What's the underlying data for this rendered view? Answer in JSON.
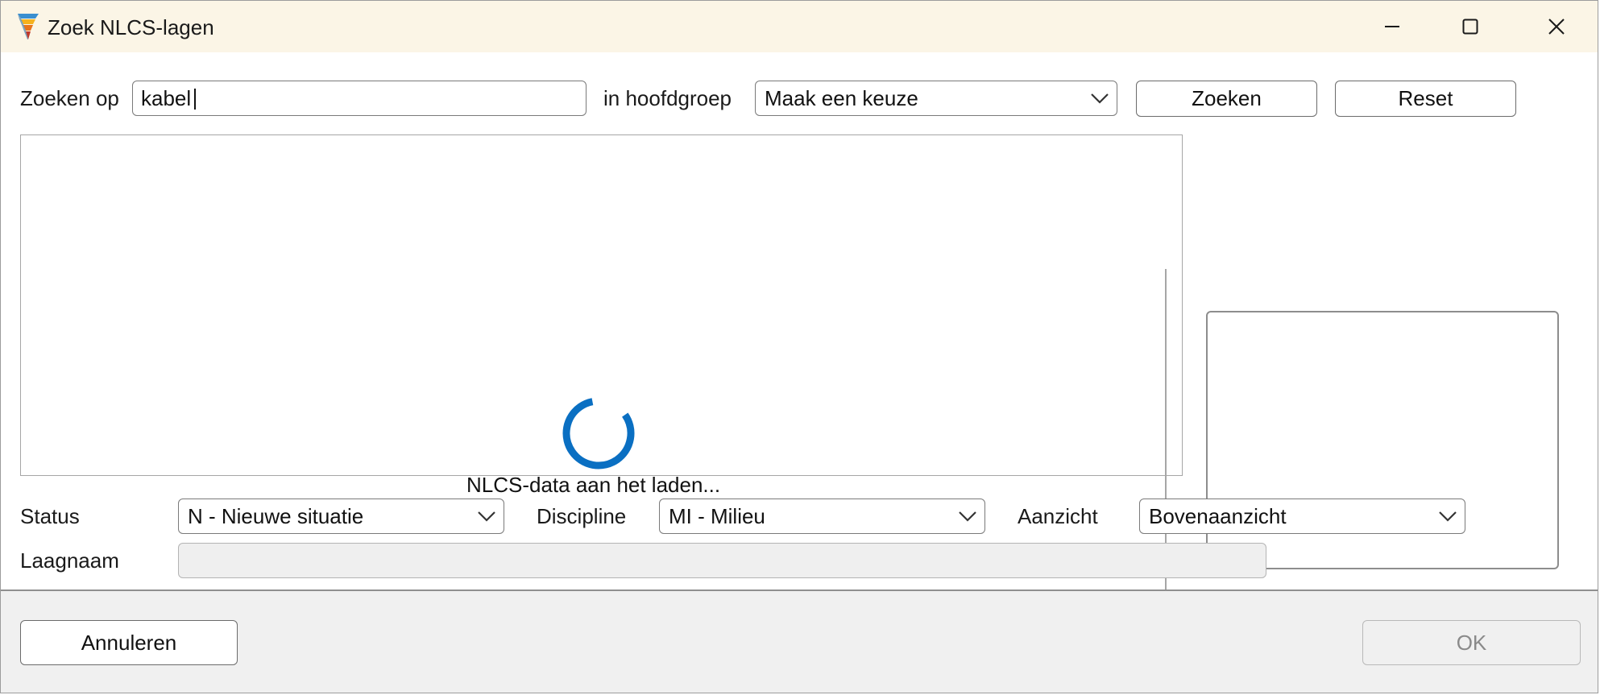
{
  "window": {
    "title": "Zoek NLCS-lagen",
    "controls": [
      "minimize-icon",
      "maximize-icon",
      "close-icon"
    ]
  },
  "search": {
    "label": "Zoeken op",
    "value": "kabel",
    "group_label": "in hoofdgroep",
    "group_value": "Maak een keuze",
    "search_button": "Zoeken",
    "reset_button": "Reset"
  },
  "results": {
    "loading_text": "NLCS-data aan het laden...",
    "spinner_color": "#0a6fc2"
  },
  "filters": {
    "status_label": "Status",
    "status_value": "N - Nieuwe situatie",
    "discipline_label": "Discipline",
    "discipline_value": "MI - Milieu",
    "aanzicht_label": "Aanzicht",
    "aanzicht_value": "Bovenaanzicht",
    "laagnaam_label": "Laagnaam",
    "laagnaam_value": ""
  },
  "footer": {
    "cancel_button": "Annuleren",
    "ok_button": "OK"
  }
}
